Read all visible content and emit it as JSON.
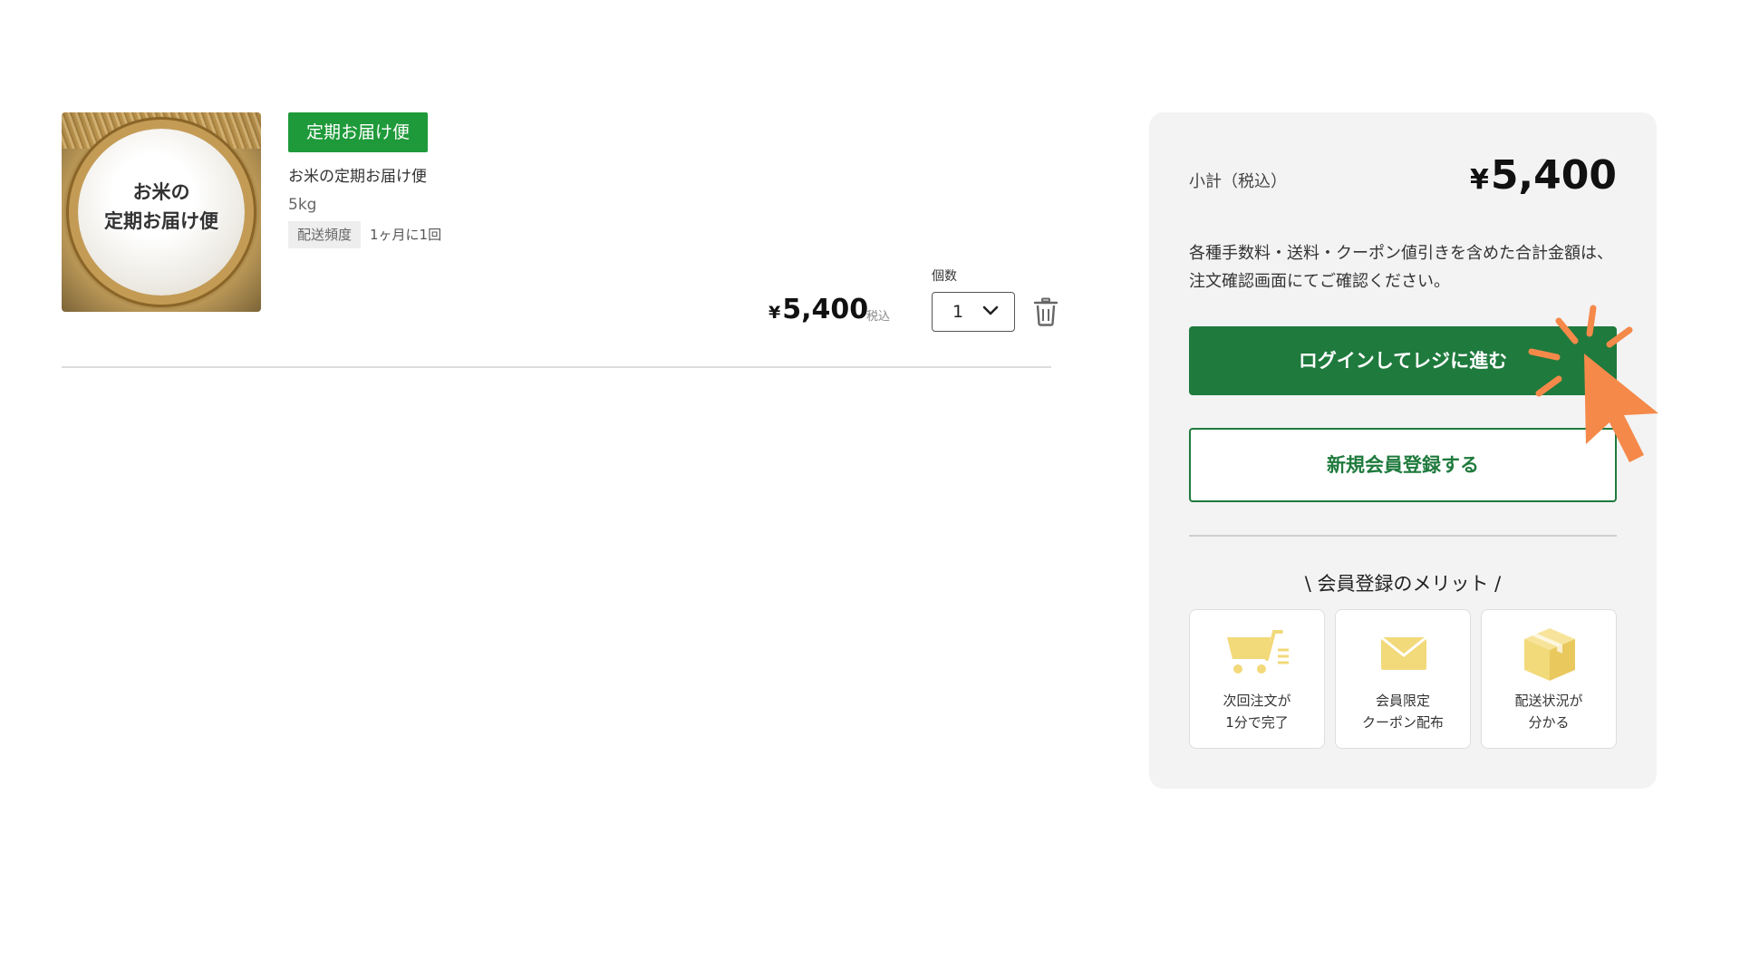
{
  "cart_item": {
    "image_caption_line1": "お米の",
    "image_caption_line2": "定期お届け便",
    "badge": "定期お届け便",
    "name": "お米の定期お届け便",
    "size": "5kg",
    "frequency_label": "配送頻度",
    "frequency_value": "1ヶ月に1回",
    "price_currency": "¥",
    "price_amount": "5,400",
    "tax_note": "税込",
    "quantity_label": "個数",
    "quantity_value": "1",
    "delete_icon": "trash-icon"
  },
  "summary": {
    "subtotal_label": "小計（税込）",
    "subtotal_currency": "¥",
    "subtotal_amount": "5,400",
    "note": "各種手数料・送料・クーポン値引きを含めた合計金額は、注文確認画面にてご確認ください。",
    "login_button": "ログインしてレジに進む",
    "register_button": "新規会員登録する",
    "merits_title": "\\ 会員登録のメリット /",
    "merits": [
      {
        "icon": "cart-icon",
        "line1": "次回注文が",
        "line2": "1分で完了"
      },
      {
        "icon": "mail-icon",
        "line1": "会員限定",
        "line2": "クーポン配布"
      },
      {
        "icon": "box-icon",
        "line1": "配送状況が",
        "line2": "分かる"
      }
    ]
  },
  "colors": {
    "badge_green": "#1f9a3a",
    "primary_green": "#1f7a3d",
    "icon_yellow": "#f2d97a",
    "pointer_orange": "#f5894a"
  }
}
